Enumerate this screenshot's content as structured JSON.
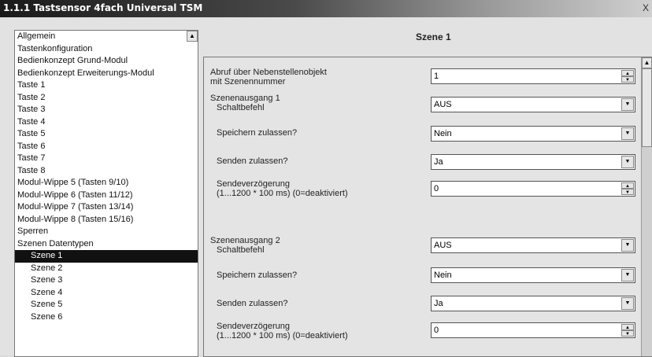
{
  "window": {
    "title": "1.1.1 Tastsensor 4fach Universal TSM",
    "close_label": "X"
  },
  "header": {
    "scene_title": "Szene 1"
  },
  "tree": {
    "items": [
      {
        "label": "Allgemein"
      },
      {
        "label": "Tastenkonfiguration"
      },
      {
        "label": "Bedienkonzept Grund-Modul"
      },
      {
        "label": "Bedienkonzept Erweiterungs-Modul"
      },
      {
        "label": "Taste 1"
      },
      {
        "label": "Taste 2"
      },
      {
        "label": "Taste 3"
      },
      {
        "label": "Taste 4"
      },
      {
        "label": "Taste 5"
      },
      {
        "label": "Taste 6"
      },
      {
        "label": "Taste 7"
      },
      {
        "label": "Taste 8"
      },
      {
        "label": "Modul-Wippe 5 (Tasten 9/10)"
      },
      {
        "label": "Modul-Wippe 6 (Tasten 11/12)"
      },
      {
        "label": "Modul-Wippe 7 (Tasten 13/14)"
      },
      {
        "label": "Modul-Wippe 8 (Tasten 15/16)"
      },
      {
        "label": "Sperren"
      },
      {
        "label": "Szenen Datentypen"
      },
      {
        "label": "Szene 1"
      },
      {
        "label": "Szene 2"
      },
      {
        "label": "Szene 3"
      },
      {
        "label": "Szene 4"
      },
      {
        "label": "Szene 5"
      },
      {
        "label": "Szene 6"
      }
    ],
    "selected": "Szene 1"
  },
  "params": {
    "abruf": {
      "label_line1": "Abruf über Nebenstellenobjekt",
      "label_line2": "mit Szenennummer",
      "value": "1"
    },
    "ausgang1": {
      "heading": "Szenenausgang 1",
      "schalt_label": "Schaltbefehl",
      "schalt_value": "AUS",
      "speichern_label": "Speichern zulassen?",
      "speichern_value": "Nein",
      "senden_label": "Senden zulassen?",
      "senden_value": "Ja",
      "verz_line1": "Sendeverzögerung",
      "verz_line2": "(1...1200 * 100 ms) (0=deaktiviert)",
      "verz_value": "0"
    },
    "ausgang2": {
      "heading": "Szenenausgang 2",
      "schalt_label": "Schaltbefehl",
      "schalt_value": "AUS",
      "speichern_label": "Speichern zulassen?",
      "speichern_value": "Nein",
      "senden_label": "Senden zulassen?",
      "senden_value": "Ja",
      "verz_line1": "Sendeverzögerung",
      "verz_line2": "(1...1200 * 100 ms) (0=deaktiviert)",
      "verz_value": "0"
    }
  },
  "icons": {
    "dropdown": "chevron-down-icon",
    "spin_up": "chevron-up-icon",
    "spin_down": "chevron-down-icon",
    "scroll_up": "chevron-up-icon"
  }
}
